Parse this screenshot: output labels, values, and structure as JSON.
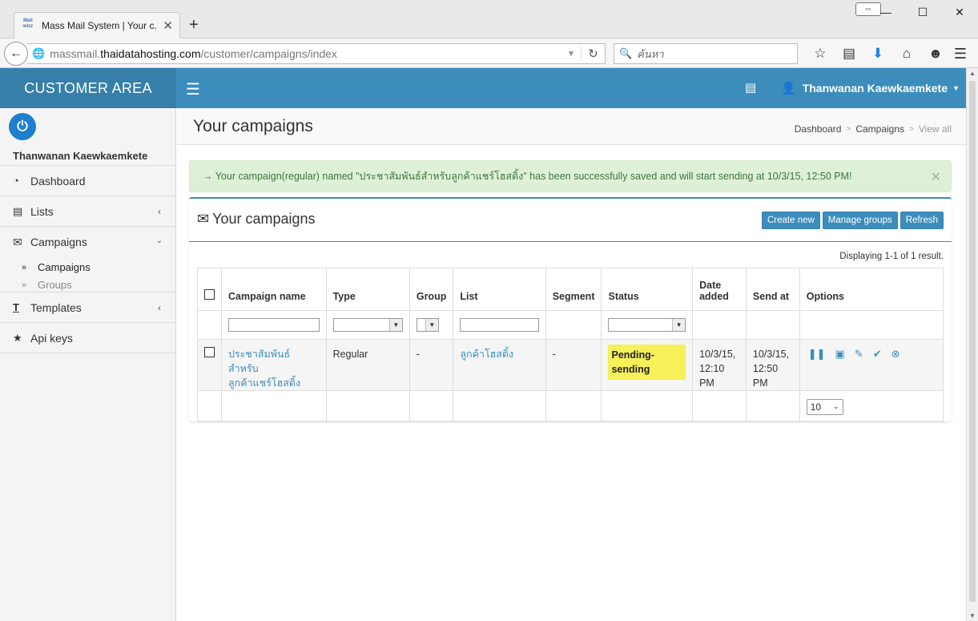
{
  "browser": {
    "tab_title": "Mass Mail System | Your c...",
    "favicon_text": "Mail\nwizz",
    "url_prefix": "massmail.",
    "url_domain": "thaidatahosting.com",
    "url_path": "/customer/campaigns/index",
    "search_placeholder": "ค้นหา",
    "resize_glyph": "⇔"
  },
  "header": {
    "brand": "CUSTOMER AREA",
    "user_name": "Thanwanan Kaewkaemkete"
  },
  "sidebar": {
    "user_name": "Thanwanan Kaewkaemkete",
    "items": {
      "dashboard": "Dashboard",
      "lists": "Lists",
      "campaigns": "Campaigns",
      "campaigns_sub": "Campaigns",
      "groups_sub": "Groups",
      "templates": "Templates",
      "api_keys": "Api keys"
    }
  },
  "page": {
    "title": "Your campaigns",
    "breadcrumb": [
      "Dashboard",
      "Campaigns",
      "View all"
    ]
  },
  "alert": {
    "text": "→ Your campaign(regular) named \"ประชาสัมพันธ์สำหรับลูกค้าแชร์โฮสติ้ง\" has been successfully saved and will start sending at 10/3/15, 12:50 PM!"
  },
  "box": {
    "title": "Your campaigns",
    "buttons": {
      "create": "Create new",
      "groups": "Manage groups",
      "refresh": "Refresh"
    },
    "summary": "Displaying 1-1 of 1 result."
  },
  "table": {
    "headers": {
      "name": "Campaign name",
      "type": "Type",
      "group": "Group",
      "list": "List",
      "segment": "Segment",
      "status": "Status",
      "date_added_1": "Date",
      "date_added_2": "added",
      "send_at": "Send at",
      "options": "Options"
    },
    "rows": [
      {
        "name_line1": "ประชาสัมพันธ์สำหรับ",
        "name_line2": "ลูกค้าแชร์โฮสติ้ง",
        "type": "Regular",
        "group": "-",
        "list": "ลูกค้าโฮสติ้ง",
        "segment": "-",
        "status": "Pending-sending",
        "date_added_1": "10/3/15,",
        "date_added_2": "12:10 PM",
        "send_at_1": "10/3/15,",
        "send_at_2": "12:50 PM"
      }
    ],
    "page_size": "10"
  },
  "colors": {
    "header_blue": "#3c8dbc",
    "brand_blue": "#367fa9",
    "alert_green_bg": "#dff0d8",
    "status_highlight": "#f6f05a"
  }
}
